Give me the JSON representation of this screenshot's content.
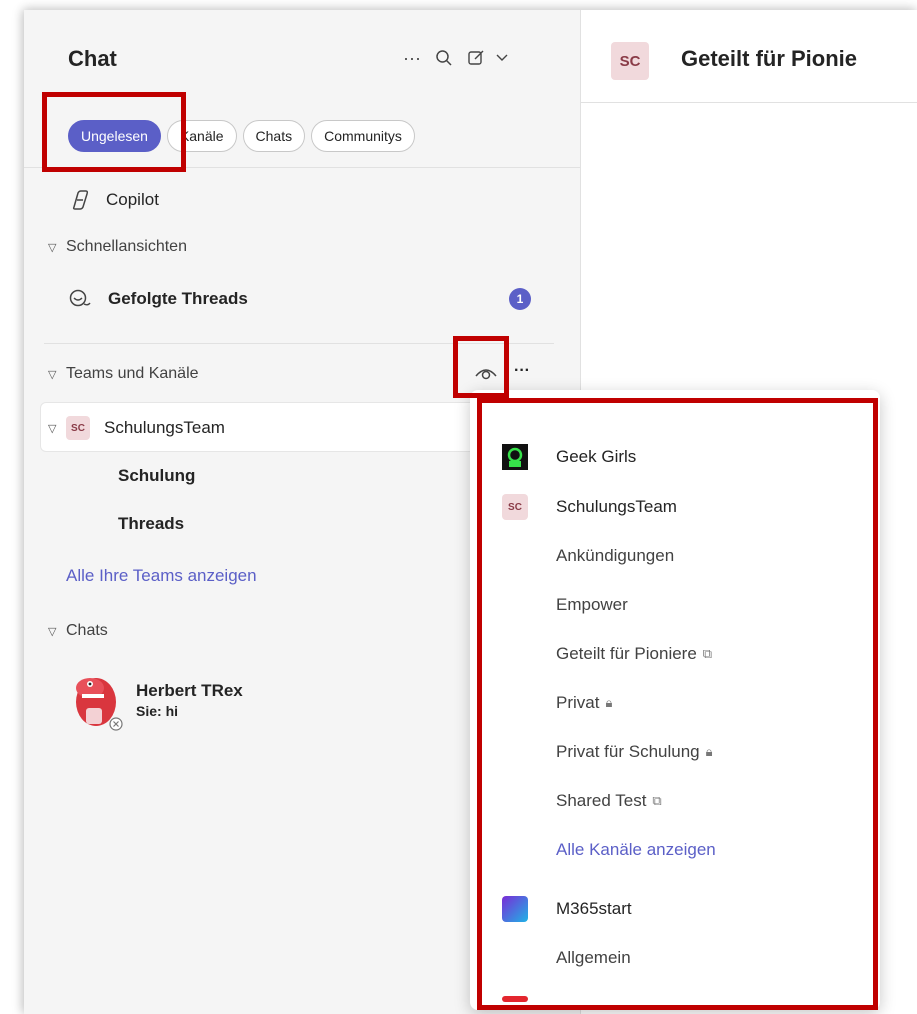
{
  "header": {
    "title": "Chat"
  },
  "header_icons": {
    "more": "···",
    "search": "⚲",
    "compose": "✎",
    "chevron": "⌄"
  },
  "filters": [
    {
      "label": "Ungelesen",
      "active": true
    },
    {
      "label": "Kanäle",
      "active": false
    },
    {
      "label": "Chats",
      "active": false
    },
    {
      "label": "Communitys",
      "active": false
    }
  ],
  "copilot": {
    "label": "Copilot"
  },
  "quick_views": {
    "heading": "Schnellansichten",
    "followed_threads": {
      "label": "Gefolgte Threads",
      "count": "1"
    }
  },
  "teams_section": {
    "heading": "Teams und Kanäle",
    "more": "···",
    "team": {
      "avatar": "SC",
      "name": "SchulungsTeam"
    },
    "channels": [
      "Schulung",
      "Threads"
    ],
    "show_all": "Alle Ihre Teams anzeigen"
  },
  "chats_section": {
    "heading": "Chats",
    "item": {
      "name": "Herbert TRex",
      "preview": "Sie: hi"
    }
  },
  "right_header": {
    "avatar": "SC",
    "title": "Geteilt für Pionie"
  },
  "popup": {
    "team1": {
      "name": "Geek Girls"
    },
    "team2": {
      "avatar": "SC",
      "name": "SchulungsTeam"
    },
    "channels": [
      {
        "label": "Ankündigungen",
        "icon": ""
      },
      {
        "label": "Empower",
        "icon": ""
      },
      {
        "label": "Geteilt für Pioniere",
        "icon": "shared"
      },
      {
        "label": "Privat",
        "icon": "lock"
      },
      {
        "label": "Privat für Schulung",
        "icon": "lock"
      },
      {
        "label": "Shared Test",
        "icon": "shared"
      }
    ],
    "show_all_channels": "Alle Kanäle anzeigen",
    "team3": {
      "name": "M365start"
    },
    "team3_channel": "Allgemein"
  },
  "colors": {
    "accent": "#5b5fc7",
    "highlight_box": "#c00000",
    "badge": "#5b5fc7"
  }
}
